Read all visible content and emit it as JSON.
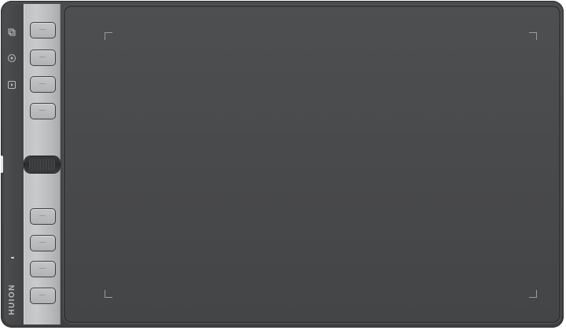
{
  "device": {
    "brand_logo": "HUION",
    "colors": {
      "body": "#434446",
      "key_panel": "#c0c1c3",
      "work_area": "#4a4b4d",
      "corner_marks": "#9a9b9d"
    }
  },
  "side_icons": [
    "layers-icon",
    "target-icon",
    "play-icon"
  ],
  "express_keys": {
    "top_group": [
      "key-1",
      "key-2",
      "key-3",
      "key-4"
    ],
    "bottom_group": [
      "key-5",
      "key-6",
      "key-7",
      "key-8"
    ]
  },
  "dial": {
    "name": "scroll-dial"
  }
}
